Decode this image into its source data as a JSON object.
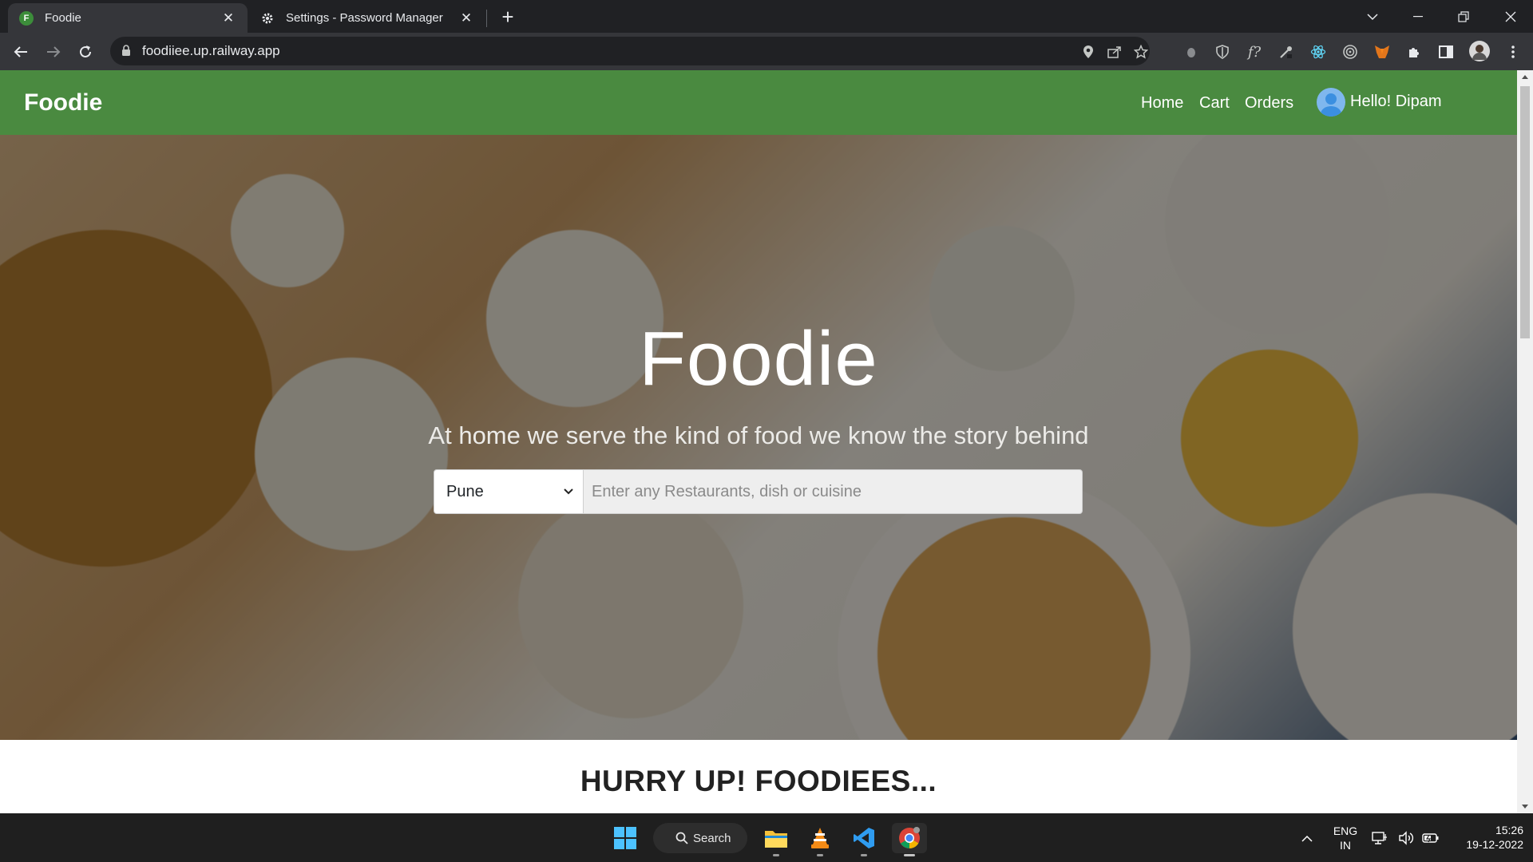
{
  "browser": {
    "tabs": [
      {
        "title": "Foodie",
        "favicon_letter": "F"
      },
      {
        "title": "Settings - Password Manager"
      }
    ],
    "url": "foodiiee.up.railway.app"
  },
  "site": {
    "brand": "Foodie",
    "nav": {
      "home": "Home",
      "cart": "Cart",
      "orders": "Orders"
    },
    "greeting": "Hello! Dipam"
  },
  "hero": {
    "title": "Foodie",
    "subtitle": "At home we serve the kind of food we know the story behind",
    "city_selected": "Pune",
    "search_placeholder": "Enter any Restaurants, dish or cuisine"
  },
  "section": {
    "title": "HURRY UP! FOODIEES..."
  },
  "taskbar": {
    "search_label": "Search",
    "lang_top": "ENG",
    "lang_bottom": "IN",
    "time": "15:26",
    "date": "19-12-2022"
  },
  "colors": {
    "nav_green": "#4a8a40",
    "chrome_dark": "#202124",
    "chrome_bar": "#35363a"
  }
}
